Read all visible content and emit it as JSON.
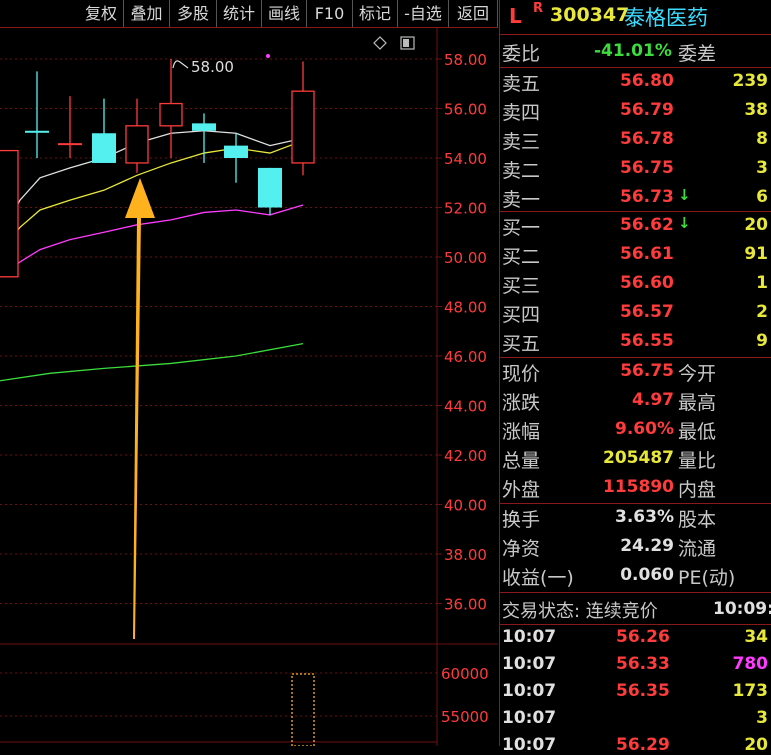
{
  "toolbar": {
    "buttons": [
      "复权",
      "叠加",
      "多股",
      "统计",
      "画线",
      "F10",
      "标记",
      "-自选",
      "返回"
    ]
  },
  "chart": {
    "price_axis": [
      "58.00",
      "56.00",
      "54.00",
      "52.00",
      "50.00",
      "48.00",
      "46.00",
      "44.00",
      "42.00",
      "40.00",
      "38.00",
      "36.00"
    ],
    "volume_axis": [
      "60000",
      "55000"
    ],
    "annotation_label": "58.00",
    "colors": {
      "grid": "#6b1111",
      "up": "#ff3b3b",
      "down": "#54f0f0",
      "ma5": "#e0e0e0",
      "ma10": "#e8e83a",
      "ma20": "#ff3bff",
      "ma60": "#3bdc3b",
      "arrow": "#ffb21e"
    }
  },
  "header": {
    "mark": "L",
    "superscript": "R",
    "code": "300347",
    "name": "泰格医药"
  },
  "order_ratio": {
    "label": "委比",
    "value": "-41.01%",
    "diff_label": "委差"
  },
  "sell_orders": [
    {
      "label": "卖五",
      "price": "56.80",
      "qty": "239",
      "trend": ""
    },
    {
      "label": "卖四",
      "price": "56.79",
      "qty": "38",
      "trend": ""
    },
    {
      "label": "卖三",
      "price": "56.78",
      "qty": "8",
      "trend": ""
    },
    {
      "label": "卖二",
      "price": "56.75",
      "qty": "3",
      "trend": ""
    },
    {
      "label": "卖一",
      "price": "56.73",
      "qty": "6",
      "trend": "down"
    }
  ],
  "buy_orders": [
    {
      "label": "买一",
      "price": "56.62",
      "qty": "20",
      "trend": "down"
    },
    {
      "label": "买二",
      "price": "56.61",
      "qty": "91",
      "trend": ""
    },
    {
      "label": "买三",
      "price": "56.60",
      "qty": "1",
      "trend": ""
    },
    {
      "label": "买四",
      "price": "56.57",
      "qty": "2",
      "trend": ""
    },
    {
      "label": "买五",
      "price": "56.55",
      "qty": "9",
      "trend": ""
    }
  ],
  "quote": [
    {
      "label": "现价",
      "value": "56.75",
      "label2": "今开"
    },
    {
      "label": "涨跌",
      "value": "4.97",
      "label2": "最高"
    },
    {
      "label": "涨幅",
      "value": "9.60%",
      "label2": "最低"
    },
    {
      "label": "总量",
      "value": "205487",
      "label2": "量比"
    },
    {
      "label": "外盘",
      "value": "115890",
      "label2": "内盘"
    }
  ],
  "stats": [
    {
      "label": "换手",
      "value": "3.63%",
      "label2": "股本"
    },
    {
      "label": "净资",
      "value": "24.29",
      "label2": "流通"
    },
    {
      "label": "收益(一)",
      "value": "0.060",
      "label2": "PE(动)"
    }
  ],
  "trade_status": {
    "label": "交易状态: 连续竞价",
    "time": "10:09:"
  },
  "ticks": [
    {
      "time": "10:07",
      "price": "56.26",
      "volume": "34",
      "vol_color": "yellow"
    },
    {
      "time": "10:07",
      "price": "56.33",
      "volume": "780",
      "vol_color": "magenta"
    },
    {
      "time": "10:07",
      "price": "56.35",
      "volume": "173",
      "vol_color": "yellow"
    },
    {
      "time": "10:07",
      "price": "",
      "volume": "3",
      "vol_color": "yellow"
    },
    {
      "time": "10:07",
      "price": "56.29",
      "volume": "20",
      "vol_color": "yellow"
    }
  ]
}
